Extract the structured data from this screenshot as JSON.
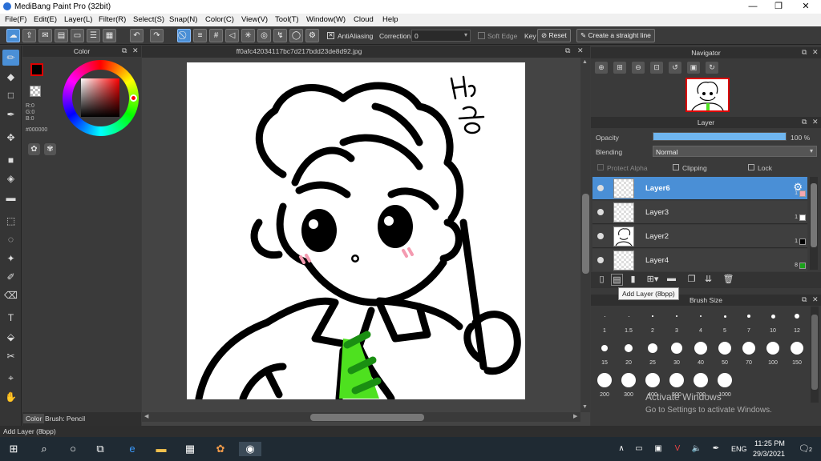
{
  "window": {
    "title": "MediBang Paint Pro (32bit)",
    "minimize": "—",
    "restore": "❐",
    "close": "✕"
  },
  "menu": [
    "File(F)",
    "Edit(E)",
    "Layer(L)",
    "Filter(R)",
    "Select(S)",
    "Snap(N)",
    "Color(C)",
    "View(V)",
    "Tool(T)",
    "Window(W)",
    "Cloud",
    "Help"
  ],
  "toolbar": {
    "antialiasing_label": "AntiAliasing",
    "correction_label": "Correction",
    "correction_value": "0",
    "soft_edge_label": "Soft Edge",
    "key_label": "Key",
    "reset_label": "Reset",
    "straight_line_label": "Create a straight line"
  },
  "color_panel": {
    "title": "Color",
    "rgb": [
      "R:0",
      "G:0",
      "B:0"
    ],
    "hex": "#000000",
    "foreground": "#000000",
    "accent_ring": "#ff0000"
  },
  "document": {
    "filename": "ff0afc420341‏17bc7d217bdd23de8d92.jpg"
  },
  "navigator": {
    "title": "Navigator"
  },
  "layer_panel": {
    "title": "Layer",
    "opacity_label": "Opacity",
    "opacity_value": "100",
    "opacity_unit": "%",
    "opacity_fraction": 1.0,
    "blending_label": "Blending",
    "blending_value": "Normal",
    "protect_alpha_label": "Protect Alpha",
    "clipping_label": "Clipping",
    "lock_label": "Lock",
    "layers": [
      {
        "name": "Layer6",
        "num": "1",
        "swatch": "#f4a7b0",
        "selected": true
      },
      {
        "name": "Layer3",
        "num": "1",
        "swatch": "#ffffff",
        "selected": false
      },
      {
        "name": "Layer2",
        "num": "1",
        "swatch": "#000000",
        "selected": false
      },
      {
        "name": "Layer4",
        "num": "8",
        "swatch": "#1aa11a",
        "selected": false
      }
    ],
    "tooltip": "Add Layer (8bpp)"
  },
  "brush_size": {
    "title": "Brush Size",
    "sizes": [
      "1",
      "1.5",
      "2",
      "3",
      "4",
      "5",
      "7",
      "10",
      "12",
      "15",
      "20",
      "25",
      "30",
      "40",
      "50",
      "70",
      "100",
      "150",
      "200",
      "300",
      "400",
      "500",
      "700",
      "1000"
    ]
  },
  "bottom_tabs": {
    "color": "Color",
    "brush": "Brush: Pencil"
  },
  "status": {
    "text": "Add Layer (8bpp)"
  },
  "watermark": {
    "line1": "Activate Windows",
    "line2": "Go to Settings to activate Windows."
  },
  "taskbar": {
    "time": "11:25 PM",
    "date": "29/3/2021",
    "lang": "ENG",
    "notifications": "2"
  },
  "drawing": {
    "handwriting": "HC",
    "tie_color": "#4ee11f",
    "cheek_color": "#f49ab0"
  }
}
